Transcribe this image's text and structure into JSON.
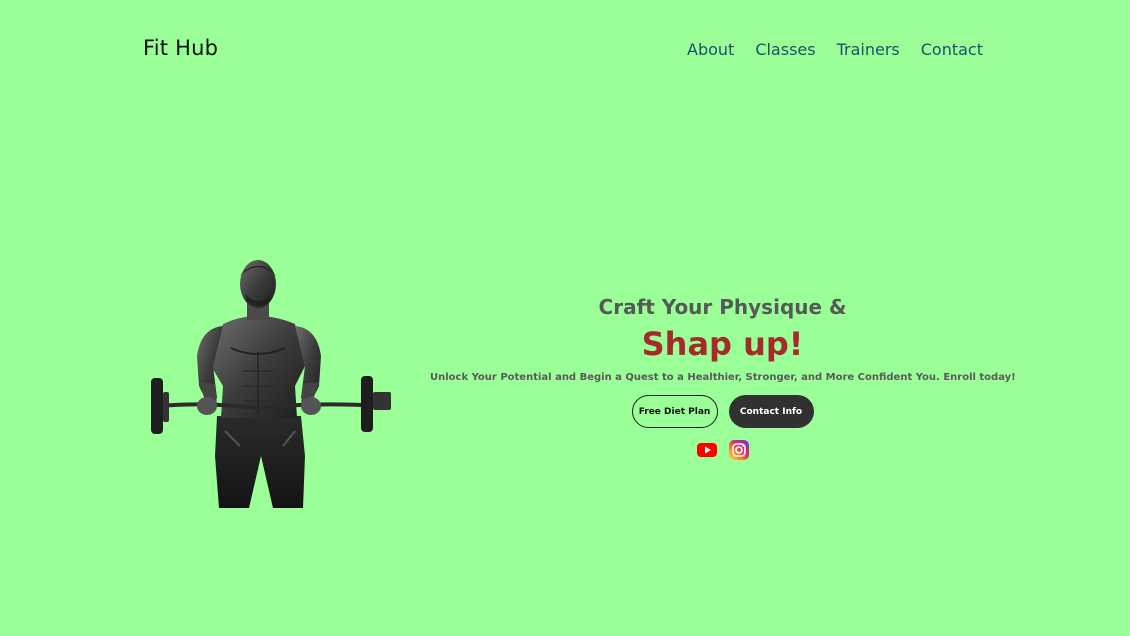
{
  "brand": {
    "name": "Fit Hub"
  },
  "nav": {
    "items": [
      {
        "label": "About"
      },
      {
        "label": "Classes"
      },
      {
        "label": "Trainers"
      },
      {
        "label": "Contact"
      }
    ]
  },
  "hero": {
    "headline": "Craft Your Physique &",
    "highlight": "Shap up!",
    "subtext": "Unlock Your Potential and Begin a Quest to a Healthier, Stronger, and More Confident You. Enroll today!",
    "primary_button": "Free Diet Plan",
    "secondary_button": "Contact Info",
    "image_icon": "bodybuilder-with-barbell-image"
  },
  "socials": [
    {
      "icon": "youtube-icon"
    },
    {
      "icon": "instagram-icon"
    }
  ],
  "colors": {
    "background": "#9bff98",
    "highlight": "#a52a2a",
    "nav_link": "#1f4f6b",
    "dark_button": "#303131"
  }
}
